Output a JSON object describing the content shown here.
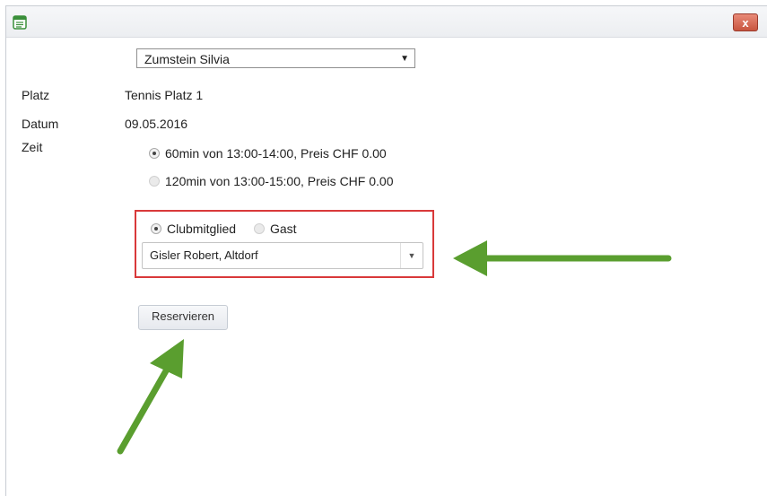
{
  "window": {
    "close_label": "x"
  },
  "form": {
    "user_select_value": "Zumstein Silvia",
    "platz_label": "Platz",
    "platz_value": "Tennis Platz 1",
    "datum_label": "Datum",
    "datum_value": "09.05.2016",
    "zeit_label": "Zeit",
    "zeit_options": [
      {
        "label": "60min von 13:00-14:00, Preis CHF 0.00",
        "selected": true
      },
      {
        "label": "120min von 13:00-15:00, Preis CHF 0.00",
        "selected": false
      }
    ],
    "partner_type_options": [
      {
        "label": "Clubmitglied",
        "selected": true
      },
      {
        "label": "Gast",
        "selected": false
      }
    ],
    "member_select_value": "Gisler Robert, Altdorf",
    "reserve_button_label": "Reservieren"
  },
  "annotations": {
    "highlight_color": "#d9393a",
    "arrow_color": "#5a9e2f"
  },
  "icons": {
    "app": "document-icon",
    "close": "close-icon",
    "dropdown": "chevron-down-icon"
  }
}
